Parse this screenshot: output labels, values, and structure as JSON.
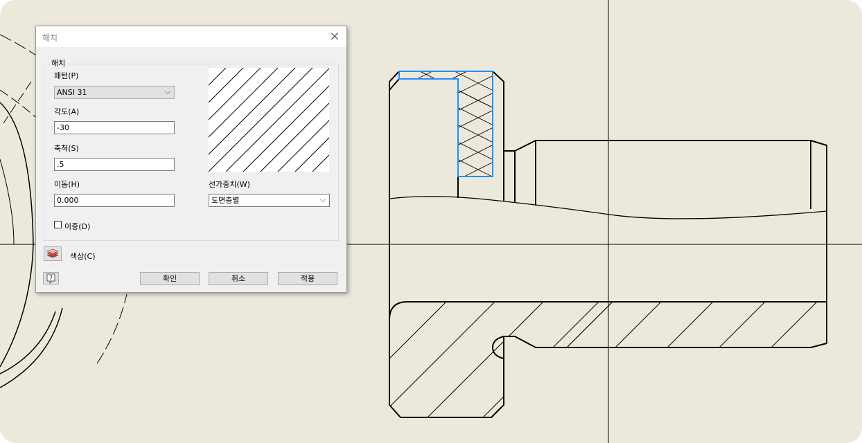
{
  "dialog": {
    "title": "해치",
    "group_label": "해치",
    "pattern_label": "패턴(P)",
    "pattern_value": "ANSI 31",
    "angle_label": "각도(A)",
    "angle_value": "-30",
    "scale_label": "축척(S)",
    "scale_value": ".5",
    "offset_label": "이동(H)",
    "offset_value": "0.000",
    "lineweight_label": "선가중치(W)",
    "lineweight_value": "도면층별",
    "double_label": "이중(D)",
    "double_checked": false,
    "color_label": "색상(C)",
    "buttons": {
      "ok": "확인",
      "cancel": "취소",
      "apply": "적용"
    }
  },
  "colors": {
    "canvas_bg": "#ece9dc",
    "selection": "#1e90ff",
    "drawing_line": "#000000"
  }
}
